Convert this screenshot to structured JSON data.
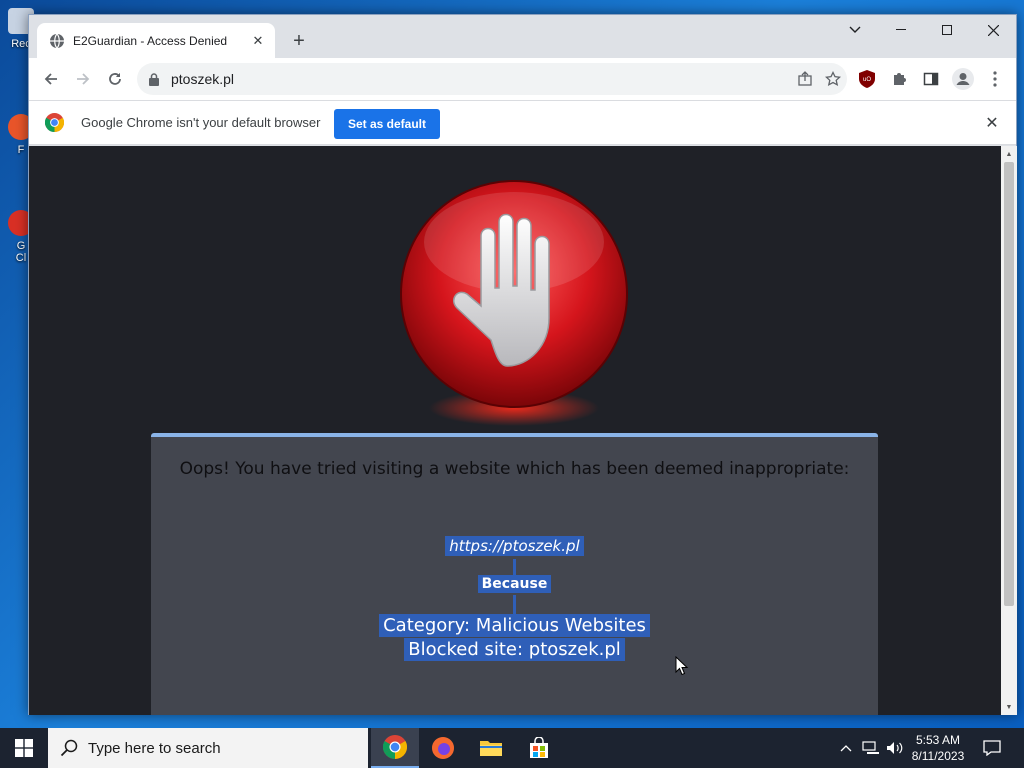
{
  "desktop": {
    "icons": [
      {
        "label": "Rec",
        "color": "#c7d3e3"
      },
      {
        "label": "F",
        "color": "#e9552a"
      },
      {
        "label": "G\nCl",
        "color": "#d93025"
      }
    ]
  },
  "browser": {
    "tab": {
      "title": "E2Guardian - Access Denied"
    },
    "omnibox": {
      "url": "ptoszek.pl"
    },
    "infobar": {
      "message": "Google Chrome isn't your default browser",
      "button_label": "Set as default"
    }
  },
  "page": {
    "headline": "Oops! You have tried visiting a website which has been deemed inappropriate:",
    "blocked_url": "https://ptoszek.pl",
    "because_label": "Because",
    "category_line": "Category: Malicious Websites",
    "blocked_site_line": "Blocked site: ptoszek.pl"
  },
  "taskbar": {
    "search_placeholder": "Type here to search",
    "time": "5:53 AM",
    "date": "8/11/2023"
  },
  "colors": {
    "accent_blue": "#1a73e8",
    "page_bg": "#1f2127",
    "panel_bg": "#43464f",
    "highlight": "#2f5fb8",
    "stop_red": "#d5151c"
  }
}
